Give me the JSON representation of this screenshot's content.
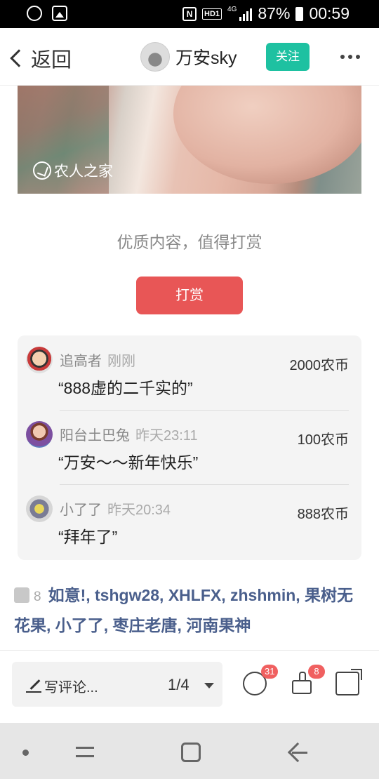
{
  "status_bar": {
    "battery": "87%",
    "time": "00:59",
    "network": "4G",
    "hd_label": "HD1",
    "nfc_label": "N"
  },
  "header": {
    "back_label": "返回",
    "author_name": "万安sky",
    "follow_label": "关注"
  },
  "article": {
    "image_watermark": "农人之家",
    "reward_prompt": "优质内容，值得打赏",
    "reward_button": "打赏"
  },
  "rewards": [
    {
      "name": "追高者",
      "time": "刚刚",
      "message": "“888虚的二千实的”",
      "amount": "2000农币"
    },
    {
      "name": "阳台土巴兔",
      "time": "昨天23:11",
      "message": "“万安～～新年快乐”",
      "amount": "100农币"
    },
    {
      "name": "小了了",
      "time": "昨天20:34",
      "message": "“拜年了”",
      "amount": "888农币"
    }
  ],
  "likes": {
    "count": "8",
    "names": "如意!, tshgw28, XHLFX, zhshmin, 果树无花果, 小了了, 枣庄老唐, 河南果神"
  },
  "bottom_bar": {
    "comment_placeholder": "写评论...",
    "page_indicator": "1/4",
    "comment_count": "31",
    "like_count": "8"
  },
  "colors": {
    "follow": "#1ec1a1",
    "reward_button": "#e85656",
    "like_names": "#4a5f8c",
    "badge": "#f06060"
  }
}
